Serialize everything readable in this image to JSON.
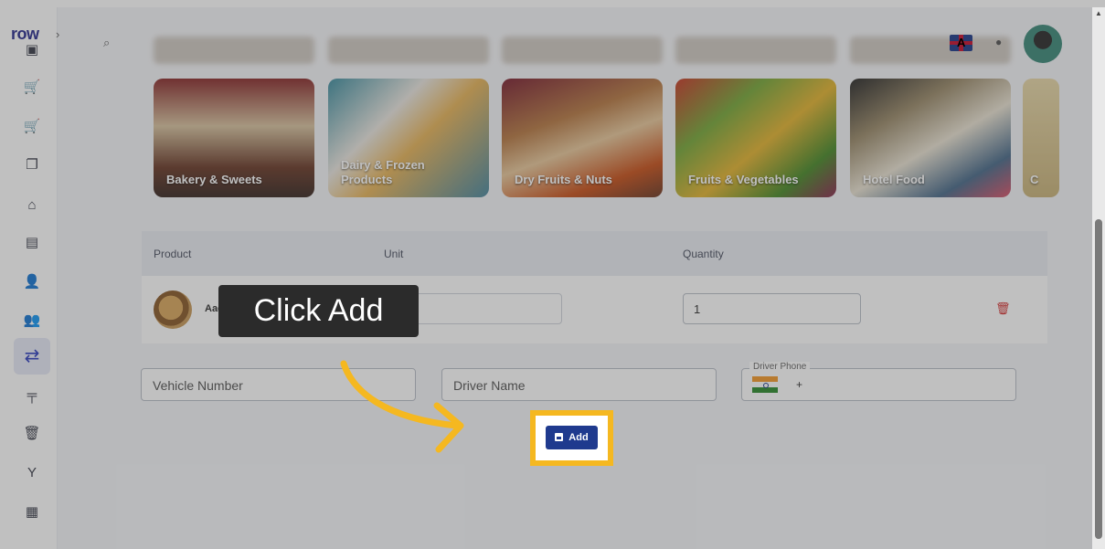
{
  "app": {
    "logo": "row",
    "expand_glyph": "›"
  },
  "sidebar": {
    "items": [
      {
        "icon": "inbox-icon"
      },
      {
        "icon": "cart-icon"
      },
      {
        "icon": "cart-add-icon"
      },
      {
        "icon": "copy-icon"
      },
      {
        "icon": "store-icon"
      },
      {
        "icon": "list-icon"
      },
      {
        "icon": "user-edit-icon"
      },
      {
        "icon": "users-icon"
      },
      {
        "icon": "transfer-icon",
        "active": true
      },
      {
        "icon": "crane-icon"
      },
      {
        "icon": "trash-icon"
      },
      {
        "icon": "plant-icon"
      },
      {
        "icon": "calculator-icon"
      }
    ]
  },
  "topbar": {
    "language_flag_letter": "A"
  },
  "categories": [
    {
      "label": "Bakery & Sweets"
    },
    {
      "label": "Dairy & Frozen Products"
    },
    {
      "label": "Dry Fruits & Nuts"
    },
    {
      "label": "Fruits & Vegetables"
    },
    {
      "label": "Hotel Food"
    },
    {
      "label": "C"
    }
  ],
  "table": {
    "headers": {
      "product": "Product",
      "unit": "Unit",
      "quantity": "Quantity"
    },
    "rows": [
      {
        "product": "Aachi M",
        "unit": "S",
        "quantity": "1"
      }
    ]
  },
  "form": {
    "vehicle_placeholder": "Vehicle Number",
    "driver_placeholder": "Driver Name",
    "phone_label": "Driver Phone",
    "phone_prefix": "+"
  },
  "actions": {
    "add_label": "Add"
  },
  "tutorial": {
    "callout": "Click Add"
  },
  "colors": {
    "primary": "#1f3a8e",
    "highlight": "#f5b820",
    "danger": "#d32f2f"
  }
}
